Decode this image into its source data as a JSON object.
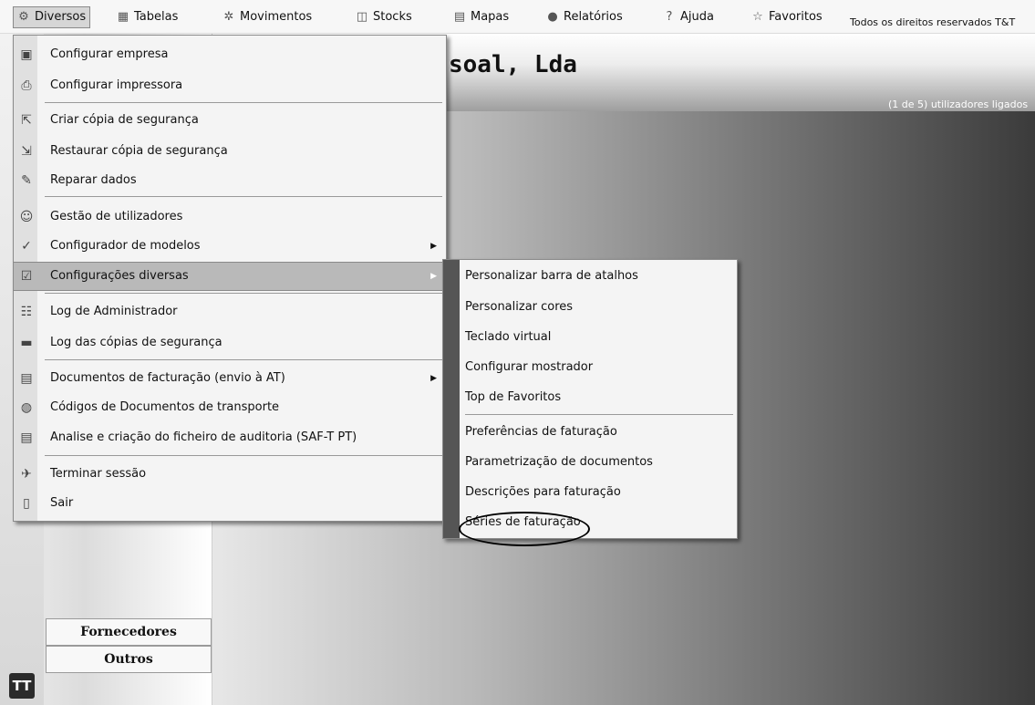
{
  "menubar": {
    "items": [
      {
        "label": "Diversos",
        "icon": "gear-box-icon"
      },
      {
        "label": "Tabelas",
        "icon": "table-icon"
      },
      {
        "label": "Movimentos",
        "icon": "cogs-icon"
      },
      {
        "label": "Stocks",
        "icon": "boxes-icon"
      },
      {
        "label": "Mapas",
        "icon": "document-icon"
      },
      {
        "label": "Relatórios",
        "icon": "reports-icon"
      },
      {
        "label": "Ajuda",
        "icon": "help-icon"
      },
      {
        "label": "Favoritos",
        "icon": "star-icon"
      }
    ],
    "copyright": "Todos os direitos reservados T&T"
  },
  "header": {
    "company_title": "soal, Lda",
    "users_status": "(1 de 5) utilizadores ligados"
  },
  "left_panel": {
    "buttons": [
      "Fornecedores",
      "Outros"
    ],
    "logo": "TT"
  },
  "main_menu": {
    "items": [
      {
        "label": "Configurar empresa",
        "icon": "company-icon"
      },
      {
        "label": "Configurar impressora",
        "icon": "printer-icon"
      },
      {
        "label": "Criar cópia de segurança",
        "icon": "backup-icon"
      },
      {
        "label": "Restaurar cópia de segurança",
        "icon": "restore-icon"
      },
      {
        "label": "Reparar dados",
        "icon": "repair-icon"
      },
      {
        "label": "Gestão de utilizadores",
        "icon": "users-icon"
      },
      {
        "label": "Configurador de modelos",
        "icon": "models-icon"
      },
      {
        "label": "Configurações diversas",
        "icon": "settings-icon"
      },
      {
        "label": "Log de Administrador",
        "icon": "admin-log-icon"
      },
      {
        "label": "Log das cópias de segurança",
        "icon": "disk-icon"
      },
      {
        "label": "Documentos de facturação (envio à AT)",
        "icon": "document-icon"
      },
      {
        "label": "Códigos de Documentos de transporte",
        "icon": "transport-icon"
      },
      {
        "label": "Analise e criação do ficheiro de auditoria (SAF-T PT)",
        "icon": "audit-icon"
      },
      {
        "label": "Terminar sessão",
        "icon": "logout-icon"
      },
      {
        "label": "Sair",
        "icon": "exit-icon"
      }
    ]
  },
  "sub_menu": {
    "items": [
      "Personalizar barra de atalhos",
      "Personalizar cores",
      "Teclado virtual",
      "Configurar mostrador",
      "Top de Favoritos",
      "Preferências de faturação",
      "Parametrização de documentos",
      "Descrições para faturação",
      "Séries de faturação"
    ]
  }
}
